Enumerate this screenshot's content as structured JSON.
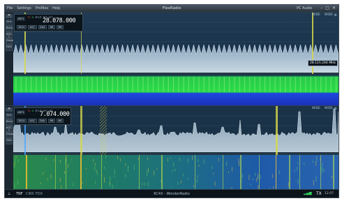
{
  "window": {
    "title": "FlexRadio",
    "menu": [
      "File",
      "Settings",
      "Profiles",
      "Help"
    ],
    "pc_audio": "PC Audio",
    "controls": [
      "–",
      "□",
      "✕"
    ]
  },
  "panadapter1": {
    "side_buttons": [
      "Ant",
      "Band",
      "AGC-T",
      "Display",
      "DAX"
    ],
    "slice": {
      "antenna": "ANT1",
      "frequency": "28.078.000",
      "flags": [
        "TX",
        "A",
        "SPLIT",
        "RIT",
        "XIT"
      ],
      "mode_chips": [
        "DIGU",
        "AGC",
        "DAX",
        "NB",
        "NR"
      ]
    },
    "scale_labels": [
      "WIDE",
      "WIDE"
    ],
    "tooltip": "28.121.244 MHz",
    "spectrum": {
      "peaks": 64,
      "floor_fraction": 0.45
    }
  },
  "panadapter2": {
    "side_buttons": [
      "Ant",
      "Band",
      "AGC-T",
      "Display",
      "DAX"
    ],
    "slice": {
      "antenna": "ANT1",
      "frequency": "7.074.000",
      "flags": [
        "TX",
        "A",
        "SPLIT",
        "RIT",
        "XIT"
      ],
      "mode_chips": [
        "DIGU",
        "AGC",
        "DAX",
        "NB",
        "NR"
      ]
    },
    "scale_labels": [
      "WIDE",
      "WIDE"
    ],
    "scale_ref": "-73dBm"
  },
  "statusbar": {
    "left": [
      "TNF",
      "CWX",
      "FDX"
    ],
    "center": "6C4X - WonderRadio",
    "right_tx": "TX",
    "clock": "12:07"
  },
  "colors": {
    "accent_yellow": "#d7d84a",
    "waterfall_green": "#22d63a",
    "waterfall_blue": "#1f3fd9",
    "background": "#0f1d28"
  }
}
